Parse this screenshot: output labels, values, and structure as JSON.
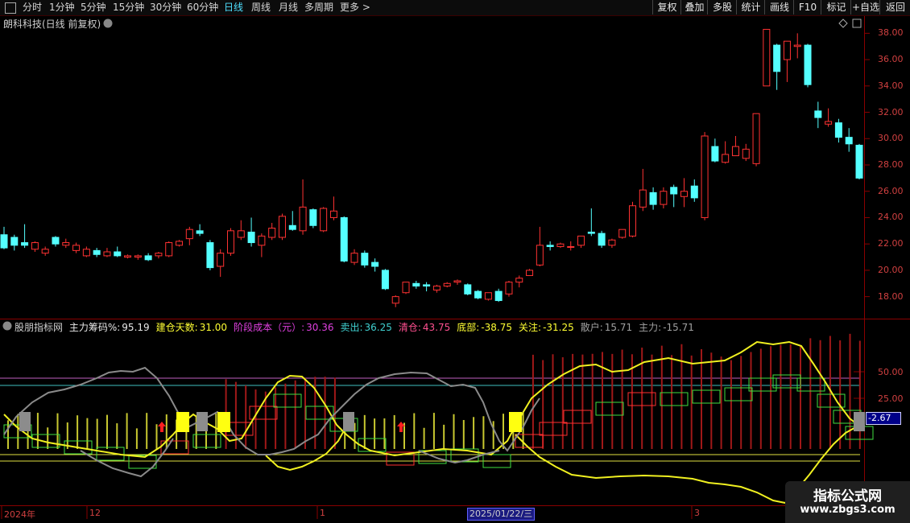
{
  "toolbar": {
    "tabs": [
      "分时",
      "1分钟",
      "5分钟",
      "15分钟",
      "30分钟",
      "60分钟",
      "日线",
      "周线",
      "月线",
      "多周期",
      "更多 >"
    ],
    "active_tab": "日线",
    "right_buttons": [
      "复权",
      "叠加",
      "多股",
      "统计",
      "画线",
      "F10",
      "标记",
      "+自选",
      "返回"
    ]
  },
  "main_chart": {
    "title": "朗科科技(日线 前复权)",
    "y_ticks": [
      "38.00",
      "36.00",
      "34.00",
      "32.00",
      "30.00",
      "28.00",
      "26.00",
      "24.00",
      "22.00",
      "20.00",
      "18.00"
    ]
  },
  "indicator": {
    "title": "股朋指标网",
    "items": [
      {
        "label": "主力筹码%:",
        "value": "95.19",
        "color": "#e8e8e8"
      },
      {
        "label": "建仓天数:",
        "value": "31.00",
        "color": "#ffff33"
      },
      {
        "label": "阶段成本（元）:",
        "value": "30.36",
        "color": "#e040e0"
      },
      {
        "label": "卖出:",
        "value": "36.25",
        "color": "#40d0d0"
      },
      {
        "label": "清仓:",
        "value": "43.75",
        "color": "#ff5090"
      },
      {
        "label": "底部:",
        "value": "-38.75",
        "color": "#ffff33"
      },
      {
        "label": "关注:",
        "value": "-31.25",
        "color": "#ffff33"
      },
      {
        "label": "散户:",
        "value": "15.71",
        "color": "#a0a0a0"
      },
      {
        "label": "主力:",
        "value": "-15.71",
        "color": "#a0a0a0"
      }
    ],
    "y_ticks": [
      "50.00",
      "25.00"
    ],
    "current_value": "-2.67"
  },
  "time_axis": {
    "labels": [
      "2024年",
      "12",
      "1",
      "3"
    ],
    "current_date": "2025/01/22/三"
  },
  "watermark": {
    "line1": "指标公式网",
    "line2": "www.zbgs3.com"
  },
  "chart_data": {
    "type": "candlestick",
    "title": "朗科科技(日线 前复权)",
    "ylim": [
      17.0,
      39.0
    ],
    "candles": [
      [
        22.7,
        21.7,
        23.3,
        21.6
      ],
      [
        22.5,
        21.9,
        22.7,
        21.5
      ],
      [
        22.1,
        21.9,
        23.5,
        21.7
      ],
      [
        21.6,
        22.1,
        22.2,
        21.4
      ],
      [
        21.3,
        21.6,
        21.8,
        21.1
      ],
      [
        22.5,
        22.0,
        22.6,
        21.8
      ],
      [
        21.9,
        22.1,
        22.4,
        21.7
      ],
      [
        21.5,
        21.9,
        22.1,
        21.3
      ],
      [
        21.1,
        21.6,
        21.8,
        21.0
      ],
      [
        21.5,
        21.2,
        21.7,
        21.0
      ],
      [
        21.1,
        21.4,
        21.7,
        21.0
      ],
      [
        21.4,
        21.1,
        21.8,
        21.0
      ],
      [
        21.0,
        21.1,
        21.2,
        20.9
      ],
      [
        21.0,
        21.1,
        21.2,
        20.8
      ],
      [
        21.1,
        20.8,
        21.3,
        20.7
      ],
      [
        21.1,
        21.3,
        21.4,
        20.9
      ],
      [
        21.1,
        22.1,
        22.2,
        21.0
      ],
      [
        21.9,
        22.2,
        22.3,
        21.8
      ],
      [
        22.4,
        23.1,
        23.3,
        21.9
      ],
      [
        23.0,
        22.8,
        23.5,
        22.6
      ],
      [
        22.1,
        20.2,
        22.3,
        20.0
      ],
      [
        20.3,
        21.3,
        21.6,
        19.5
      ],
      [
        21.3,
        23.0,
        23.2,
        21.1
      ],
      [
        22.5,
        23.0,
        23.8,
        22.3
      ],
      [
        22.9,
        22.1,
        24.0,
        21.8
      ],
      [
        21.9,
        22.6,
        22.8,
        21.0
      ],
      [
        22.5,
        23.2,
        23.6,
        22.3
      ],
      [
        22.5,
        24.1,
        24.3,
        22.3
      ],
      [
        23.4,
        23.1,
        24.5,
        23.0
      ],
      [
        23.0,
        24.8,
        26.9,
        22.7
      ],
      [
        24.6,
        23.4,
        24.7,
        23.2
      ],
      [
        23.0,
        24.7,
        24.8,
        22.9
      ],
      [
        24.0,
        24.5,
        25.6,
        23.8
      ],
      [
        24.0,
        20.7,
        24.1,
        20.6
      ],
      [
        20.6,
        21.3,
        21.6,
        20.4
      ],
      [
        21.3,
        20.4,
        21.5,
        20.2
      ],
      [
        20.6,
        20.3,
        20.9,
        19.9
      ],
      [
        20.0,
        18.6,
        20.1,
        18.5
      ],
      [
        17.5,
        18.0,
        18.1,
        17.2
      ],
      [
        18.3,
        19.1,
        19.1,
        18.2
      ],
      [
        19.0,
        18.8,
        19.2,
        18.6
      ],
      [
        18.9,
        18.8,
        19.1,
        18.4
      ],
      [
        18.5,
        18.8,
        18.9,
        18.3
      ],
      [
        18.8,
        19.0,
        19.1,
        18.7
      ],
      [
        19.1,
        19.2,
        19.3,
        18.9
      ],
      [
        18.9,
        18.2,
        19.0,
        18.1
      ],
      [
        18.4,
        17.9,
        18.5,
        17.8
      ],
      [
        17.8,
        18.3,
        18.3,
        17.7
      ],
      [
        18.4,
        17.7,
        18.6,
        17.6
      ],
      [
        18.2,
        19.1,
        19.2,
        18.0
      ],
      [
        19.1,
        19.4,
        19.6,
        18.7
      ],
      [
        19.6,
        20.0,
        20.1,
        19.6
      ],
      [
        20.4,
        21.9,
        23.3,
        20.3
      ],
      [
        21.9,
        21.8,
        22.2,
        21.5
      ],
      [
        21.8,
        22.0,
        22.1,
        21.7
      ],
      [
        21.8,
        21.8,
        22.2,
        21.5
      ],
      [
        21.9,
        22.6,
        22.6,
        21.7
      ],
      [
        22.9,
        22.8,
        24.7,
        22.6
      ],
      [
        22.8,
        21.9,
        23.0,
        21.7
      ],
      [
        21.9,
        22.3,
        22.4,
        21.7
      ],
      [
        22.5,
        23.1,
        23.1,
        22.4
      ],
      [
        22.6,
        24.9,
        25.2,
        22.5
      ],
      [
        24.8,
        26.1,
        27.7,
        24.5
      ],
      [
        25.9,
        25.0,
        26.3,
        24.6
      ],
      [
        25.0,
        26.0,
        26.3,
        24.7
      ],
      [
        26.3,
        25.8,
        26.5,
        24.8
      ],
      [
        25.6,
        26.0,
        27.0,
        24.8
      ],
      [
        26.4,
        25.5,
        26.9,
        25.2
      ],
      [
        24.0,
        30.2,
        30.5,
        23.8
      ],
      [
        29.4,
        28.3,
        30.0,
        28.2
      ],
      [
        28.2,
        28.8,
        29.8,
        28.1
      ],
      [
        28.7,
        29.4,
        30.2,
        28.7
      ],
      [
        28.5,
        29.2,
        29.6,
        28.3
      ],
      [
        28.1,
        31.9,
        31.9,
        27.9
      ],
      [
        34.0,
        38.3,
        38.3,
        34.0
      ],
      [
        37.1,
        35.1,
        37.2,
        33.7
      ],
      [
        36.0,
        37.4,
        37.4,
        34.3
      ],
      [
        37.0,
        37.1,
        38.0,
        36.1
      ],
      [
        37.1,
        34.1,
        37.2,
        33.9
      ],
      [
        32.1,
        31.6,
        32.8,
        30.8
      ],
      [
        31.1,
        31.3,
        32.3,
        30.9
      ],
      [
        31.2,
        30.1,
        31.5,
        29.7
      ],
      [
        30.1,
        29.6,
        30.8,
        29.0
      ],
      [
        29.5,
        27.0,
        29.6,
        26.9
      ]
    ]
  }
}
